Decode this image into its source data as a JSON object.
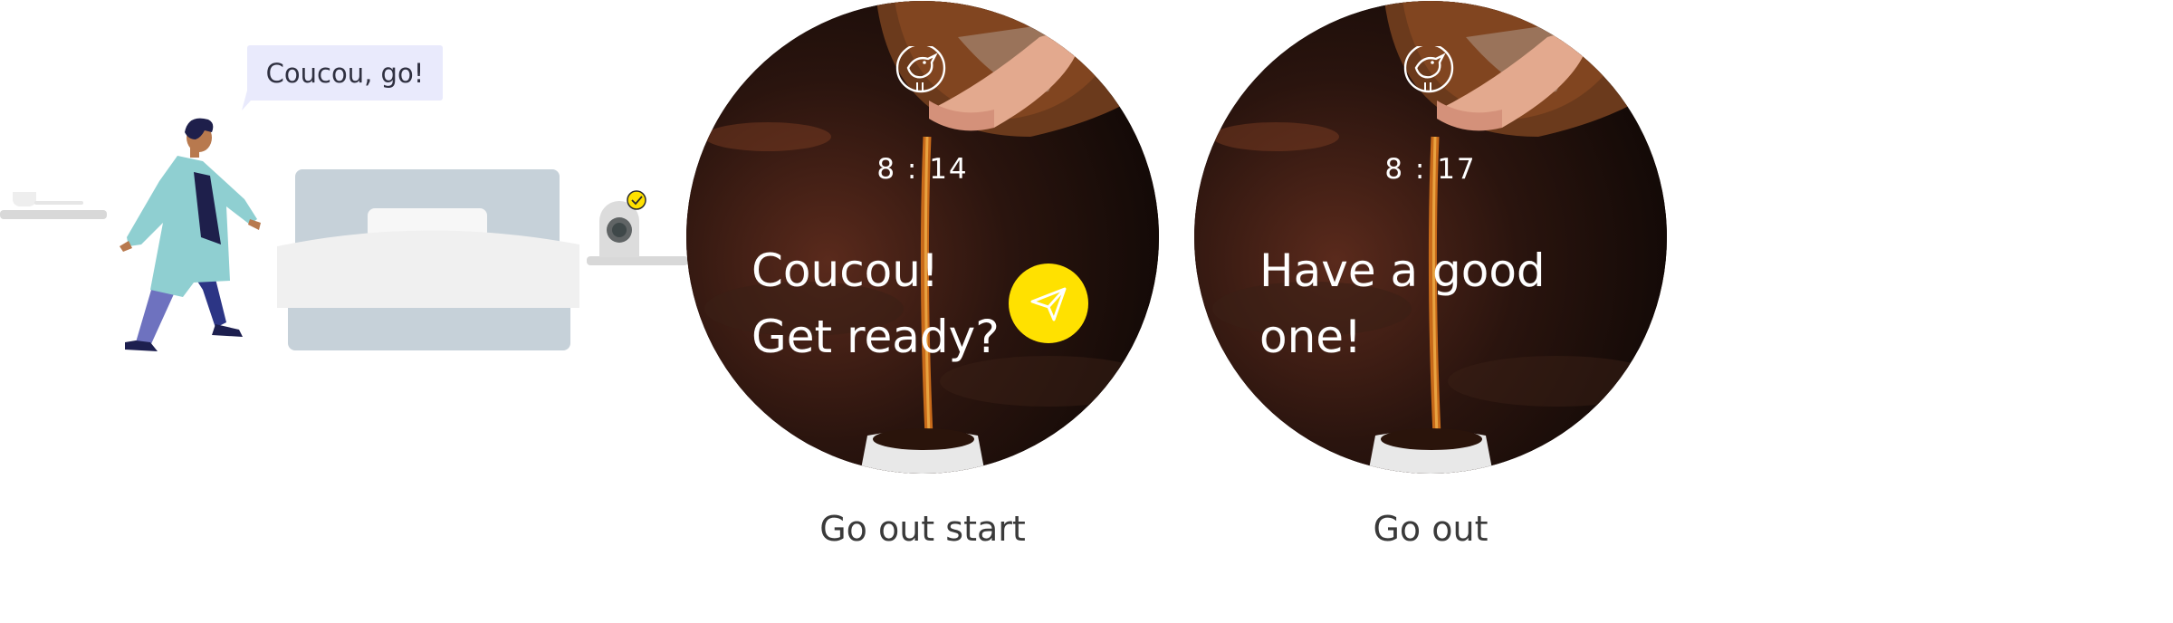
{
  "bubble": {
    "text": "Coucou, go!"
  },
  "screens": [
    {
      "time": "8 : 14",
      "message": "Coucou!\nGet ready?",
      "caption": "Go out start",
      "has_send_button": true
    },
    {
      "time": "8 : 17",
      "message": "Have a good\none!",
      "caption": "Go out",
      "has_send_button": false
    }
  ],
  "colors": {
    "accent": "#ffe100",
    "bubble_bg": "#e9eafc",
    "coat": "#8fcfd1",
    "pants": "#2c3585",
    "bed_frame": "#c6d1d9",
    "bed_sheet": "#f0f0f0"
  },
  "icons": [
    "bird-icon",
    "send-icon",
    "check-icon"
  ]
}
